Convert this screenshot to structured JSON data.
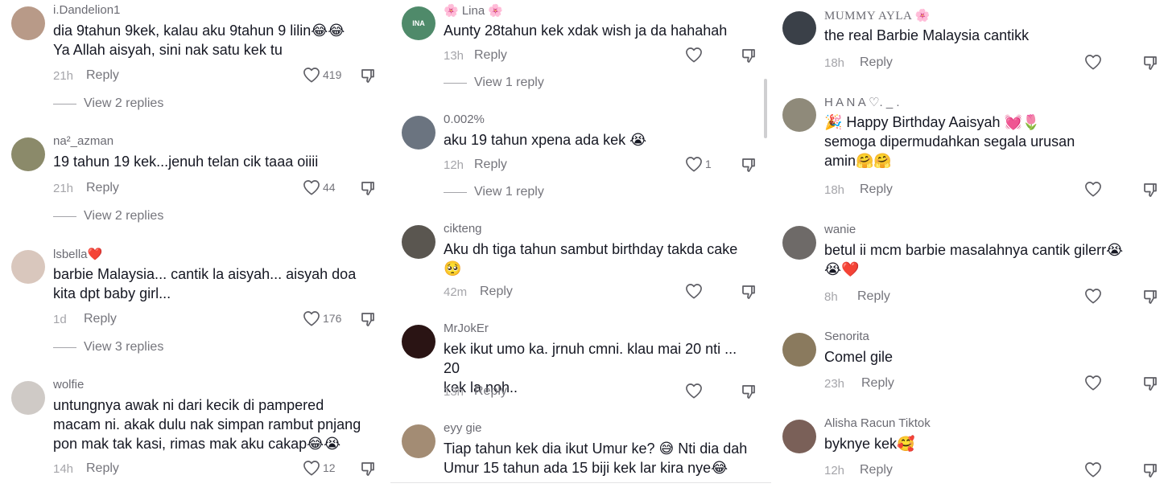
{
  "columns": [
    {
      "comments": [
        {
          "username": "i.Dandelion1",
          "lines": [
            "dia 9tahun 9kek, kalau aku 9tahun 9 lilin😂😂",
            "Ya Allah aisyah, sini nak satu kek tu"
          ],
          "time": "21h",
          "reply": "Reply",
          "likes": "419",
          "view_replies": "View 2 replies",
          "avatar_color": "#b89a88"
        },
        {
          "username": "na²_azman",
          "lines": [
            "19 tahun 19 kek...jenuh telan cik taaa oiiii"
          ],
          "time": "21h",
          "reply": "Reply",
          "likes": "44",
          "view_replies": "View 2 replies",
          "avatar_color": "#8b8a6a"
        },
        {
          "username": "lsbella❤️",
          "lines": [
            "barbie Malaysia... cantik la aisyah... aisyah doa",
            "kita dpt baby girl..."
          ],
          "time": "1d",
          "reply": "Reply",
          "likes": "176",
          "view_replies": "View 3 replies",
          "avatar_color": "#d9c7bd"
        },
        {
          "username": "wolfie",
          "lines": [
            "untungnya awak ni dari kecik di pampered",
            "macam ni. akak dulu nak simpan rambut pnjang",
            "pon mak tak kasi, rimas mak aku cakap😂😭"
          ],
          "time": "14h",
          "reply": "Reply",
          "likes": "12",
          "view_replies": "",
          "avatar_color": "#cfcac6"
        }
      ]
    },
    {
      "comments": [
        {
          "username": "🌸 Lina 🌸",
          "lines": [
            "Aunty 28tahun kek xdak wish ja da hahahah"
          ],
          "time": "13h",
          "reply": "Reply",
          "likes": "",
          "view_replies": "View 1 reply",
          "avatar_color": "#4f8a6a",
          "avatar_text": "INA"
        },
        {
          "username": "0.002%",
          "lines": [
            "aku 19 tahun xpena ada kek 😭"
          ],
          "time": "12h",
          "reply": "Reply",
          "likes": "1",
          "view_replies": "View 1 reply",
          "avatar_color": "#6b7480"
        },
        {
          "username": "cikteng",
          "lines": [
            "Aku dh tiga tahun sambut birthday takda cake",
            "🥺"
          ],
          "time": "42m",
          "reply": "Reply",
          "likes": "",
          "view_replies": "",
          "avatar_color": "#5a5650"
        },
        {
          "username": "MrJokEr",
          "lines": [
            "kek ikut umo ka. jrnuh cmni. klau mai 20 nti ... 20",
            "kek la noh.."
          ],
          "time": "13h",
          "reply": "Reply",
          "likes": "",
          "view_replies": "",
          "avatar_color": "#2a1414"
        },
        {
          "username": "eyy gie",
          "lines": [
            "Tiap tahun kek dia ikut Umur ke? 😅 Nti dia dah",
            "Umur 15 tahun ada 15 biji kek lar kira nye😂"
          ],
          "time": "",
          "reply": "",
          "likes": "",
          "view_replies": "",
          "avatar_color": "#a38c74"
        }
      ]
    },
    {
      "comments": [
        {
          "username": "MUMMY AYLA 🌸",
          "lines": [
            "the real Barbie Malaysia cantikk"
          ],
          "time": "18h",
          "reply": "Reply",
          "likes": "",
          "view_replies": "",
          "avatar_color": "#3a4048"
        },
        {
          "username": "H A N A ♡. _ .",
          "lines": [
            "🎉 Happy Birthday Aaisyah 💓🌷",
            "semoga dipermudahkan segala urusan",
            "amin🤗🤗"
          ],
          "time": "18h",
          "reply": "Reply",
          "likes": "",
          "view_replies": "",
          "avatar_color": "#8f8a7a"
        },
        {
          "username": "wanie",
          "lines": [
            "betul ii mcm barbie masalahnya cantik gilerr😭",
            "😭❤️"
          ],
          "time": "8h",
          "reply": "Reply",
          "likes": "",
          "view_replies": "",
          "avatar_color": "#6e6a68"
        },
        {
          "username": "Senorita",
          "lines": [
            "Comel gile"
          ],
          "time": "23h",
          "reply": "Reply",
          "likes": "",
          "view_replies": "",
          "avatar_color": "#8a7a5e"
        },
        {
          "username": "Alisha Racun Tiktok",
          "lines": [
            "byknye kek🥰"
          ],
          "time": "12h",
          "reply": "Reply",
          "likes": "",
          "view_replies": "",
          "avatar_color": "#7a6058"
        }
      ]
    }
  ],
  "icons": {
    "like": "heart-outline-icon",
    "dislike": "thumbs-down-icon"
  },
  "colors": {
    "text": "#161823",
    "muted": "#75757c",
    "time": "#a5a5aa",
    "username": "#6b6b73"
  }
}
